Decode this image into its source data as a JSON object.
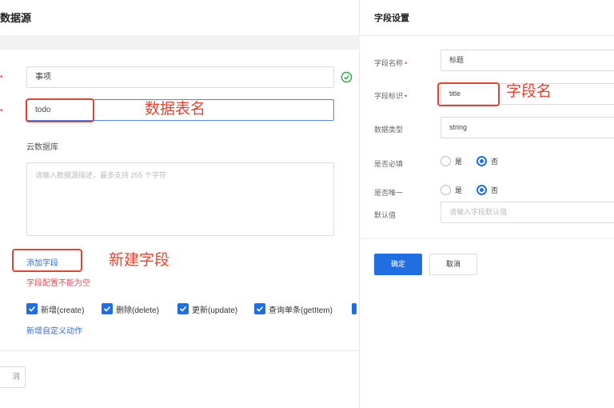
{
  "left": {
    "title": "数据源",
    "name_value": "事项",
    "id_value": "todo",
    "db_label": "云数据库",
    "desc_placeholder": "请输入数据源描述，最多支持 255 个字符",
    "add_field_link": "添加字段",
    "field_error": "字段配置不能为空",
    "actions": [
      "新增(create)",
      "删除(delete)",
      "更新(update)",
      "查询单条(getItem)"
    ],
    "add_custom_action": "新增自定义动作",
    "bottom_button": "消"
  },
  "annotations": {
    "table_name": "数据表名",
    "new_field": "新建字段",
    "field_name": "字段名"
  },
  "right": {
    "title": "字段设置",
    "field_name_label": "字段名称",
    "field_name_value": "标题",
    "field_id_label": "字段标识",
    "field_id_value": "title",
    "data_type_label": "数据类型",
    "data_type_value": "string",
    "required_label": "是否必填",
    "unique_label": "是否唯一",
    "yes": "是",
    "no": "否",
    "default_label": "默认值",
    "default_placeholder": "请输入字段默认值",
    "confirm_button": "确定",
    "cancel_button": "取消"
  },
  "colors": {
    "primary": "#1f6fe0",
    "annotation": "#e8402e",
    "error": "#e34d59",
    "success": "#27a844"
  }
}
